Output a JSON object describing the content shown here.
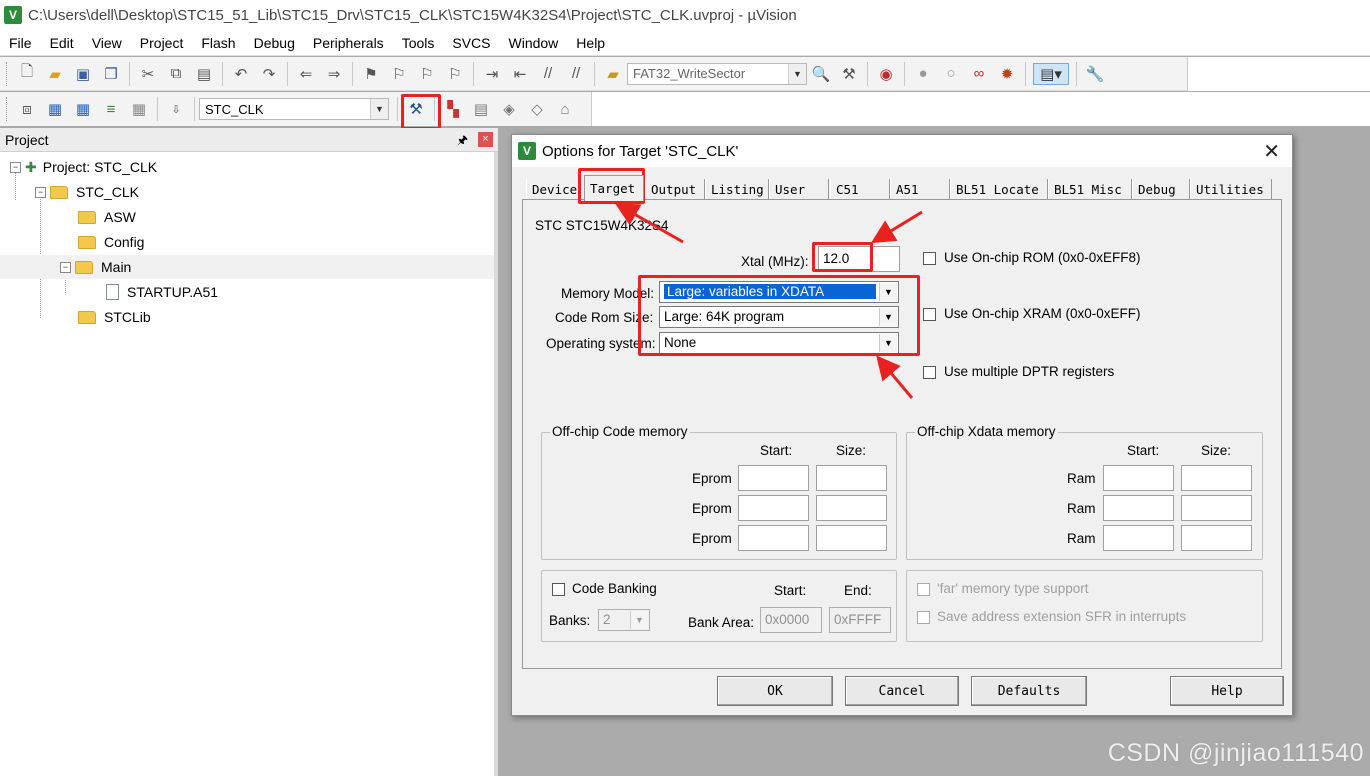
{
  "window": {
    "title": "C:\\Users\\dell\\Desktop\\STC15_51_Lib\\STC15_Drv\\STC15_CLK\\STC15W4K32S4\\Project\\STC_CLK.uvproj - µVision",
    "app_icon": "V"
  },
  "menu": [
    "File",
    "Edit",
    "View",
    "Project",
    "Flash",
    "Debug",
    "Peripherals",
    "Tools",
    "SVCS",
    "Window",
    "Help"
  ],
  "toolbar": {
    "find_combo_value": "FAT32_WriteSector",
    "target_combo_value": "STC_CLK"
  },
  "project_panel": {
    "title": "Project",
    "pin": "ᴾ",
    "close": "×",
    "tree": [
      {
        "label": "Project: STC_CLK",
        "level": 0,
        "kind": "project",
        "expander": "−"
      },
      {
        "label": "STC_CLK",
        "level": 1,
        "kind": "target",
        "expander": "−"
      },
      {
        "label": "ASW",
        "level": 2,
        "kind": "folder",
        "expander": ""
      },
      {
        "label": "Config",
        "level": 2,
        "kind": "folder",
        "expander": ""
      },
      {
        "label": "Main",
        "level": 2,
        "kind": "folder",
        "expander": "−"
      },
      {
        "label": "STARTUP.A51",
        "level": 3,
        "kind": "file",
        "expander": ""
      },
      {
        "label": "STCLib",
        "level": 2,
        "kind": "folder",
        "expander": ""
      }
    ]
  },
  "dialog": {
    "title": "Options for Target 'STC_CLK'",
    "icon": "V",
    "close": "✕",
    "tabs": [
      "Device",
      "Target",
      "Output",
      "Listing",
      "User",
      "C51",
      "A51",
      "BL51 Locate",
      "BL51 Misc",
      "Debug",
      "Utilities"
    ],
    "active_tab": "Target",
    "device_name": "STC STC15W4K32S4",
    "xtal_label": "Xtal (MHz):",
    "xtal_value": "12.0",
    "memory_model_label": "Memory Model:",
    "memory_model_value": "Large: variables in XDATA",
    "code_rom_label": "Code Rom Size:",
    "code_rom_value": "Large: 64K program",
    "os_label": "Operating system:",
    "os_value": "None",
    "use_onchip_rom": "Use On-chip ROM (0x0-0xEFF8)",
    "use_onchip_xram": "Use On-chip XRAM (0x0-0xEFF)",
    "use_multiple_dptr": "Use multiple DPTR registers",
    "offchip_code": {
      "title": "Off-chip Code memory",
      "start_header": "Start:",
      "size_header": "Size:",
      "rows": [
        "Eprom",
        "Eprom",
        "Eprom"
      ]
    },
    "offchip_xdata": {
      "title": "Off-chip Xdata memory",
      "start_header": "Start:",
      "size_header": "Size:",
      "rows": [
        "Ram",
        "Ram",
        "Ram"
      ]
    },
    "banking": {
      "code_banking_label": "Code Banking",
      "start_header": "Start:",
      "end_header": "End:",
      "banks_label": "Banks:",
      "banks_value": "2",
      "bank_area_label": "Bank Area:",
      "bank_area_start": "0x0000",
      "bank_area_end": "0xFFFF"
    },
    "far_memory": "'far' memory type support",
    "save_address": "Save address extension SFR in interrupts",
    "buttons": {
      "ok": "OK",
      "cancel": "Cancel",
      "defaults": "Defaults",
      "help": "Help"
    }
  },
  "watermark": "CSDN @jinjiao111540",
  "colors": {
    "annotation_red": "#e8231f",
    "selection_blue": "#0a64d6"
  }
}
